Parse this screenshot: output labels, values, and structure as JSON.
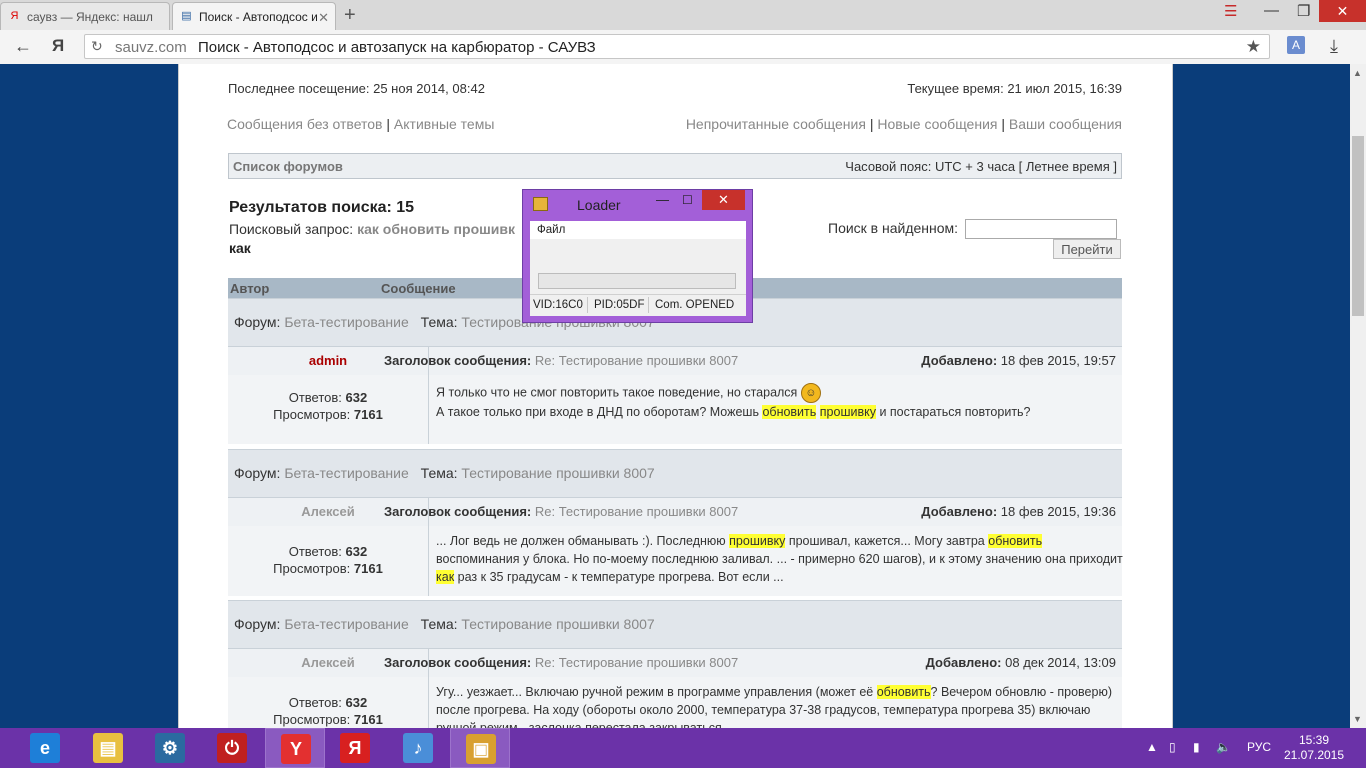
{
  "browser": {
    "tabs": [
      {
        "label": "саувз — Яндекс: нашл",
        "favicon": "Я"
      },
      {
        "label": "Поиск - Автоподсос и",
        "favicon": "▤"
      }
    ],
    "url_domain": "sauvz.com",
    "url_title": "Поиск - Автоподсос и автозапуск на карбюратор - САУВЗ"
  },
  "page": {
    "last_visit": "Последнее посещение: 25 ноя 2014, 08:42",
    "current_time": "Текущее время: 21 июл 2015, 16:39",
    "links_left": [
      "Сообщения без ответов",
      "Активные темы"
    ],
    "links_right": [
      "Непрочитанные сообщения",
      "Новые сообщения",
      "Ваши сообщения"
    ],
    "separator": "|",
    "forum_list": "Список форумов",
    "timezone": "Часовой пояс: UTC + 3 часа [ Летнее время ]",
    "results_title": "Результатов поиска: 15",
    "query_label": "Поисковый запрос:",
    "query_value": "как обновить прошивк",
    "query_tail": "как",
    "search_in_label": "Поиск в найденном:",
    "go_button": "Перейти",
    "col_author": "Автор",
    "col_message": "Сообщение",
    "labels": {
      "forum": "Форум:",
      "topic": "Тема:",
      "subject": "Заголовок сообщения:",
      "added": "Добавлено:",
      "replies": "Ответов:",
      "views": "Просмотров:"
    },
    "posts": [
      {
        "forum": "Бета-тестирование",
        "topic": "Тестирование прошивки 8007",
        "author": "admin",
        "subject": "Re: Тестирование прошивки 8007",
        "date": "18 фев 2015, 19:57",
        "replies": "632",
        "views": "7161",
        "text": {
          "l1": "Я только что не смог повторить такое поведение, но старался",
          "l2a": "А такое только при входе в ДНД по оборотам? Можешь",
          "h1": "обновить",
          "h2": "прошивку",
          "l2b": "и постараться повторить?"
        }
      },
      {
        "forum": "Бета-тестирование",
        "topic": "Тестирование прошивки 8007",
        "author": "Алексей",
        "subject": "Re: Тестирование прошивки 8007",
        "date": "18 фев 2015, 19:36",
        "replies": "632",
        "views": "7161",
        "text": {
          "p1": "... Лог ведь не должен обманывать :). Последнюю",
          "h1": "прошивку",
          "p2": "прошивал, кажется... Могу завтра",
          "h2": "обновить",
          "p3": "воспоминания у блока. Но по-моему последнюю заливал. ... - примерно 620 шагов), и к этому значению она приходит",
          "h3": "как",
          "p4": "раз к 35 градусам - к температуре прогрева. Вот если ..."
        }
      },
      {
        "forum": "Бета-тестирование",
        "topic": "Тестирование прошивки 8007",
        "author": "Алексей",
        "subject": "Re: Тестирование прошивки 8007",
        "date": "08 дек 2014, 13:09",
        "replies": "632",
        "views": "7161",
        "text": {
          "p1": "Угу... уезжает... Включаю ручной режим в программе управления (может её",
          "h1": "обновить",
          "p2": "? Вечером обновлю - проверю) после прогрева. На ходу (обороты около 2000, температура 37-38 градусов, температура прогрева 35) включаю ручной режим - заслонка перестала закрываться..."
        }
      }
    ]
  },
  "loader": {
    "title": "Loader",
    "menu": "Файл",
    "progress": 0,
    "vid": "VID:16C0",
    "pid": "PID:05DF",
    "com": "Com. OPENED"
  },
  "taskbar": {
    "items": [
      {
        "name": "ie-icon",
        "glyph": "e",
        "color": "#1e7fd8"
      },
      {
        "name": "explorer-icon",
        "glyph": "▤",
        "color": "#e8c040"
      },
      {
        "name": "settings-app-icon",
        "glyph": "⚙",
        "color": "#2b6aa0"
      },
      {
        "name": "power-app-icon",
        "glyph": "⏻",
        "color": "#c02020"
      },
      {
        "name": "yandex-browser-icon",
        "glyph": "Y",
        "color": "#e33030"
      },
      {
        "name": "yandex-icon",
        "glyph": "Я",
        "color": "#d82020"
      },
      {
        "name": "sound-app-icon",
        "glyph": "♪",
        "color": "#4a8ed8"
      },
      {
        "name": "loader-app-icon",
        "glyph": "▣",
        "color": "#d8a030"
      }
    ],
    "lang": "РУС",
    "time": "15:39",
    "date": "21.07.2015"
  }
}
